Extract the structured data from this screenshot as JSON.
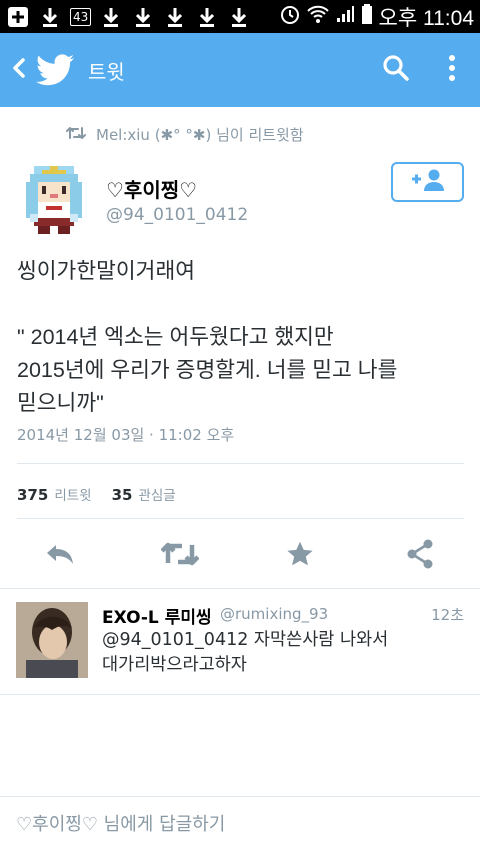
{
  "status_bar": {
    "notification_count": "43",
    "time": "오후 11:04"
  },
  "app_bar": {
    "title": "트윗",
    "color": "#55acee"
  },
  "retweet_context": "Mel:xiu (✱° °✱) 님이 리트윗함",
  "tweet": {
    "display_name": "♡후이찡♡",
    "handle": "@94_0101_0412",
    "text": "씽이가한말이거래여\n\n\" 2014년 엑소는 어두웠다고 했지만\n2015년에 우리가 증명할게. 너를 믿고 나를\n믿으니까\"",
    "timestamp": "2014년 12월 03일 · 11:02 오후",
    "retweet_count": "375",
    "retweet_label": "리트윗",
    "favorite_count": "35",
    "favorite_label": "관심글"
  },
  "reply": {
    "display_name": "EXO-L 루미씽",
    "handle": "@rumixing_93",
    "time": "12초",
    "text": "@94_0101_0412 자막쓴사람 나와서\n대가리박으라고하자"
  },
  "compose": {
    "placeholder": "♡후이찡♡ 님에게 답글하기"
  },
  "icons": {
    "back": "chevron-left-icon",
    "logo": "twitter-bird-icon",
    "search": "search-icon",
    "more": "more-vertical-icon",
    "follow": "add-user-icon",
    "reply": "reply-icon",
    "retweet": "retweet-icon",
    "favorite": "star-icon",
    "share": "share-icon"
  }
}
